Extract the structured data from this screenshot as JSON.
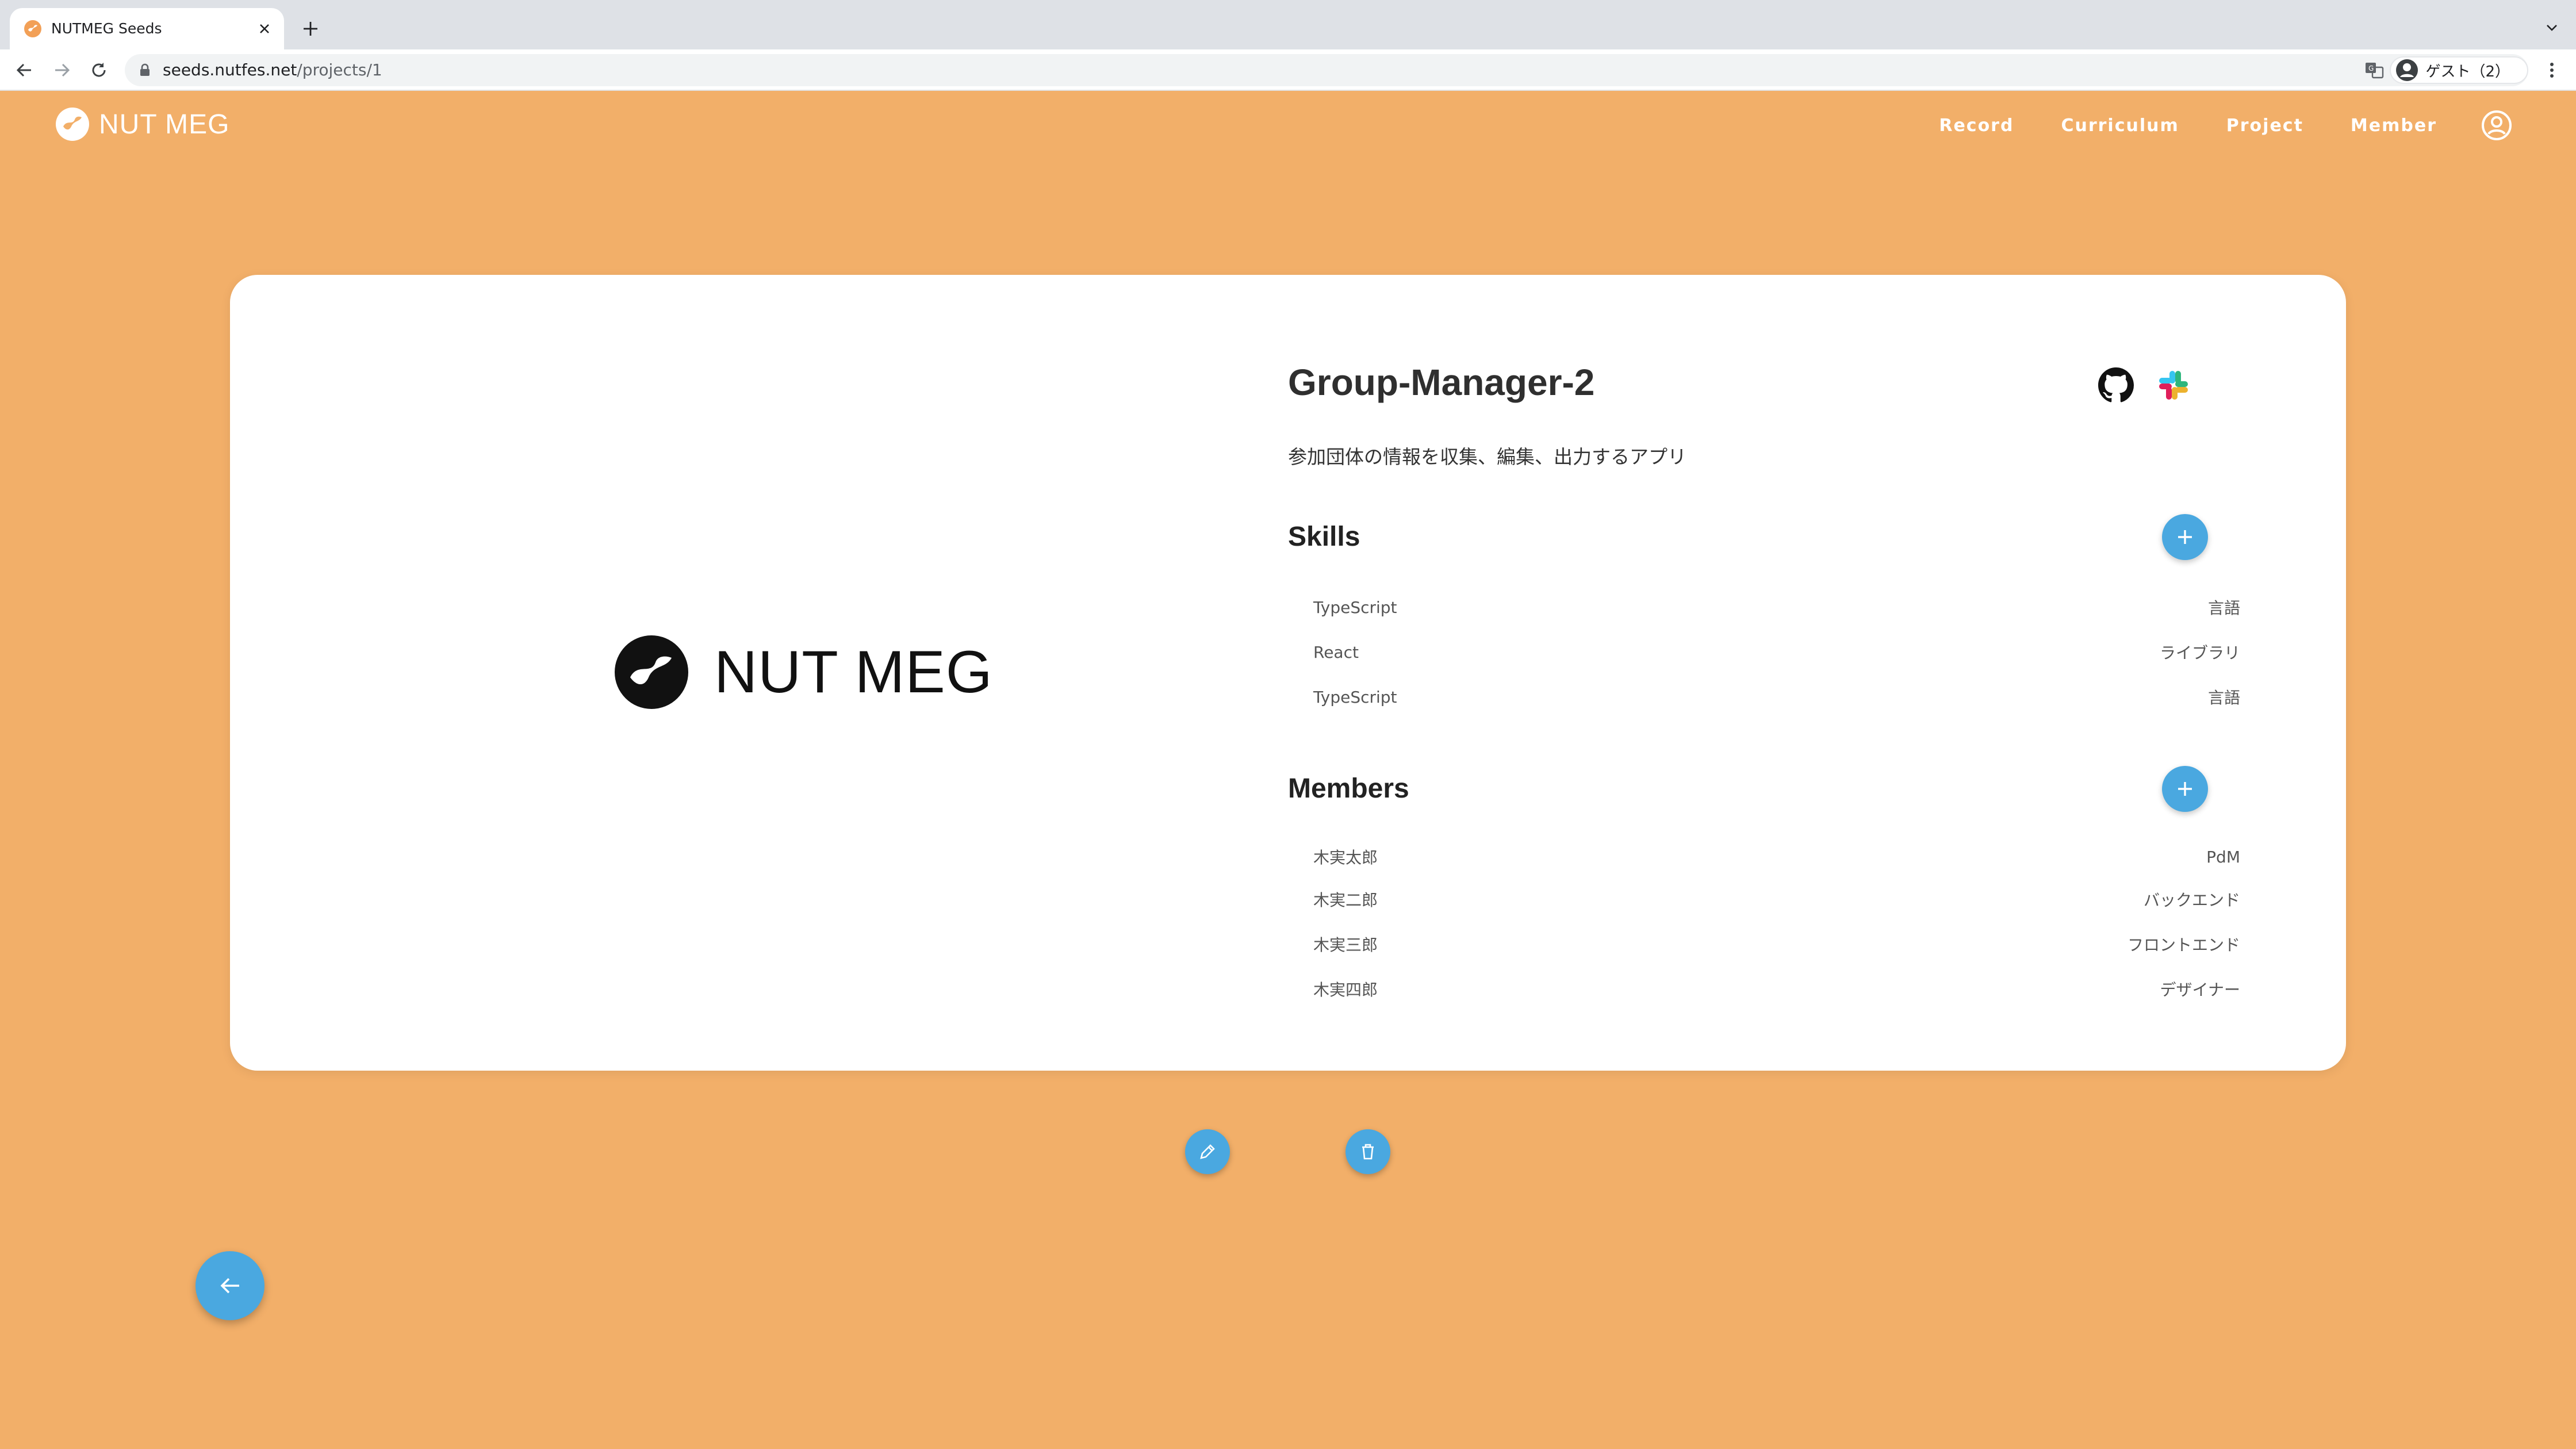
{
  "browser": {
    "tab_title": "NUTMEG Seeds",
    "url_host": "seeds.nutfes.net",
    "url_path": "/projects/1",
    "profile_label": "ゲスト（2）"
  },
  "header": {
    "brand": "NUT MEG",
    "nav": [
      "Record",
      "Curriculum",
      "Project",
      "Member"
    ]
  },
  "project": {
    "logo_text": "NUT MEG",
    "title": "Group-Manager-2",
    "description": "参加団体の情報を収集、編集、出力するアプリ",
    "links": [
      "github-icon",
      "slack-icon"
    ]
  },
  "skills": {
    "heading": "Skills",
    "items": [
      {
        "name": "TypeScript",
        "category": "言語"
      },
      {
        "name": "React",
        "category": "ライブラリ"
      },
      {
        "name": "TypeScript",
        "category": "言語"
      }
    ]
  },
  "members": {
    "heading": "Members",
    "items": [
      {
        "name": "木実太郎",
        "role": "PdM"
      },
      {
        "name": "木実二郎",
        "role": "バックエンド"
      },
      {
        "name": "木実三郎",
        "role": "フロントエンド"
      },
      {
        "name": "木実四郎",
        "role": "デザイナー"
      }
    ]
  },
  "colors": {
    "background": "#f2af69",
    "accent": "#4aa8e0",
    "card": "#ffffff"
  },
  "actions": [
    "edit-icon",
    "trash-icon",
    "arrow-left-icon"
  ]
}
